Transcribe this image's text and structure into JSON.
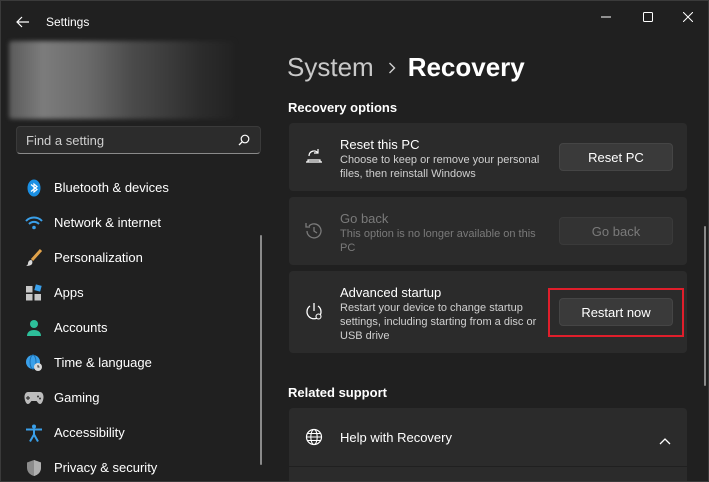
{
  "window": {
    "title": "Settings"
  },
  "search": {
    "placeholder": "Find a setting"
  },
  "nav": {
    "items": [
      {
        "label": "Bluetooth & devices",
        "icon": "bluetooth-icon"
      },
      {
        "label": "Network & internet",
        "icon": "wifi-icon"
      },
      {
        "label": "Personalization",
        "icon": "brush-icon"
      },
      {
        "label": "Apps",
        "icon": "apps-icon"
      },
      {
        "label": "Accounts",
        "icon": "person-icon"
      },
      {
        "label": "Time & language",
        "icon": "globe-clock-icon"
      },
      {
        "label": "Gaming",
        "icon": "gamepad-icon"
      },
      {
        "label": "Accessibility",
        "icon": "accessibility-icon"
      },
      {
        "label": "Privacy & security",
        "icon": "shield-icon"
      }
    ]
  },
  "breadcrumb": {
    "parent": "System",
    "current": "Recovery"
  },
  "recovery_options": {
    "title": "Recovery options",
    "reset": {
      "title": "Reset this PC",
      "description": "Choose to keep or remove your personal files, then reinstall Windows",
      "button": "Reset PC"
    },
    "go_back": {
      "title": "Go back",
      "description": "This option is no longer available on this PC",
      "button": "Go back"
    },
    "advanced": {
      "title": "Advanced startup",
      "description": "Restart your device to change startup settings, including starting from a disc or USB drive",
      "button": "Restart now"
    }
  },
  "related_support": {
    "title": "Related support",
    "help": {
      "title": "Help with Recovery"
    }
  },
  "colors": {
    "background": "#202020",
    "card": "#2b2b2b",
    "highlight": "#e01e2b"
  }
}
